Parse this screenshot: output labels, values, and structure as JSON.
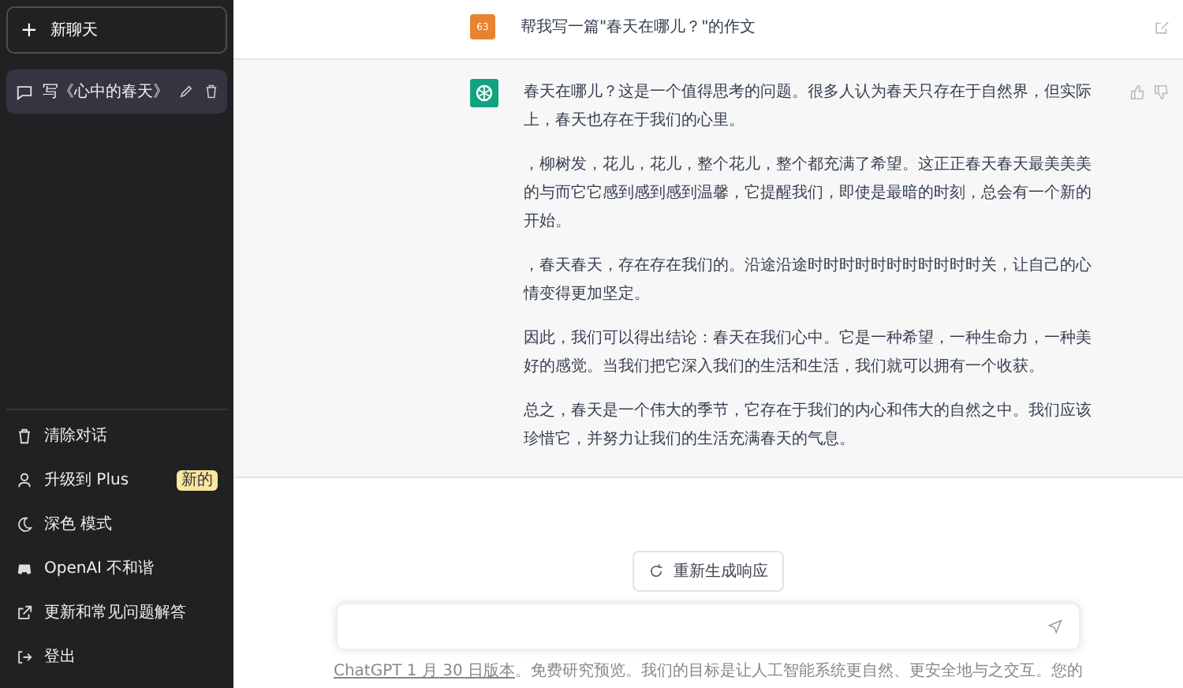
{
  "sidebar": {
    "new_chat": {
      "icon": "+",
      "label": "新聊天"
    },
    "conversations": [
      {
        "title": "写《心中的春天》",
        "selected": true
      }
    ],
    "menu": [
      {
        "kind": "trash",
        "label": "清除对话"
      },
      {
        "kind": "user",
        "label": "升级到 Plus",
        "badge": "新的"
      },
      {
        "kind": "moon",
        "label": "深色 模式"
      },
      {
        "kind": "discord",
        "label": "OpenAI 不和谐"
      },
      {
        "kind": "external",
        "label": "更新和常见问题解答"
      },
      {
        "kind": "logout",
        "label": "登出"
      }
    ]
  },
  "messages": [
    {
      "kind": "user",
      "avatar": "63",
      "text": "帮我写一篇\"春天在哪儿？\"的作文"
    },
    {
      "kind": "assistant",
      "paragraphs": [
        "春天在哪儿？这是一个值得思考的问题。很多人认为春天只存在于自然界，但实际上，春天也存在于我们的心里。",
        "，柳树发，花儿，花儿，整个花儿，整个都充满了希望。这正正春天春天最美美美的与而它它感到感到感到温馨，它提醒我们，即使是最暗的时刻，总会有一个新的开始。",
        "，春天春天，存在存在我们的。沿途沿途时时时时时时时时时时时关，让自己的心情变得更加坚定。",
        "因此，我们可以得出结论：春天在我们心中。它是一种希望，一种生命力，一种美好的感觉。当我们把它深入我们的生活和生活，我们就可以拥有一个收获。",
        "总之，春天是一个伟大的季节，它存在于我们的内心和伟大的自然之中。我们应该珍惜它，并努力让我们的生活充满春天的气息。"
      ]
    }
  ],
  "regenerate": {
    "label": "重新生成响应"
  },
  "footer": {
    "link": "ChatGPT 1 月 30 日版本",
    "text": "。免费研究预览。我们的目标是让人工智能系统更自然、更安全地与之交互。您的"
  }
}
